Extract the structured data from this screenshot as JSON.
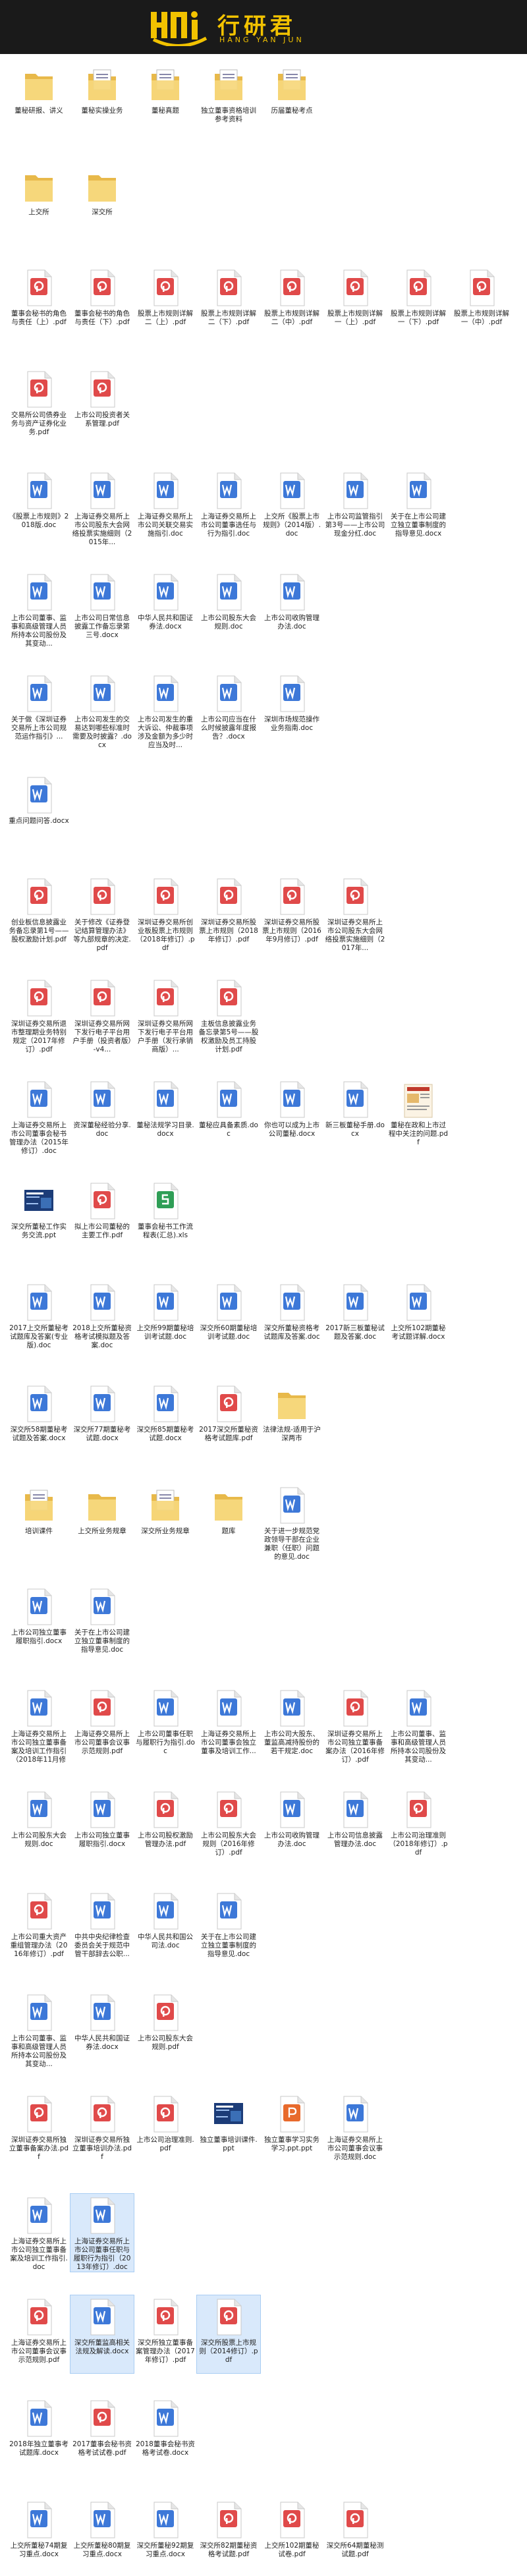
{
  "brand": {
    "name_cn": "行研君",
    "name_en": "HANG YAN JUN"
  },
  "files": [
    {
      "label": "董秘研报、讲义",
      "type": "folder"
    },
    {
      "label": "董秘实操业务",
      "type": "folder_doc"
    },
    {
      "label": "董秘真题",
      "type": "folder_doc"
    },
    {
      "label": "独立董事资格培训参考资料",
      "type": "folder_doc"
    },
    {
      "label": "历届董秘考点",
      "type": "folder_doc"
    },
    {
      "label": "上交所",
      "type": "folder"
    },
    {
      "label": "深交所",
      "type": "folder"
    },
    {
      "label": "董事会秘书的角色与责任（上）.pdf",
      "type": "pdf"
    },
    {
      "label": "董事会秘书的角色与责任（下）.pdf",
      "type": "pdf"
    },
    {
      "label": "股票上市规则详解二（上）.pdf",
      "type": "pdf"
    },
    {
      "label": "股票上市规则详解二（下）.pdf",
      "type": "pdf"
    },
    {
      "label": "股票上市规则详解二（中）.pdf",
      "type": "pdf"
    },
    {
      "label": "股票上市规则详解一（上）.pdf",
      "type": "pdf"
    },
    {
      "label": "股票上市规则详解一（下）.pdf",
      "type": "pdf"
    },
    {
      "label": "股票上市规则详解一（中）.pdf",
      "type": "pdf"
    },
    {
      "label": "交易所公司债券业务与资产证券化业务.pdf",
      "type": "pdf"
    },
    {
      "label": "上市公司投资者关系管理.pdf",
      "type": "pdf"
    },
    {
      "label": "《股票上市规则》2018版.doc",
      "type": "doc"
    },
    {
      "label": "上海证券交易所上市公司股东大会网络投票实施细则（2015年...",
      "type": "doc"
    },
    {
      "label": "上海证券交易所上市公司关联交易实施指引.doc",
      "type": "doc"
    },
    {
      "label": "上海证券交易所上市公司董事选任与行为指引.doc",
      "type": "doc"
    },
    {
      "label": "上交所《股票上市规则》（2014版）.doc",
      "type": "doc"
    },
    {
      "label": "上市公司监管指引第3号——上市公司现金分红.doc",
      "type": "doc"
    },
    {
      "label": "关于在上市公司建立独立董事制度的指导意见.docx",
      "type": "doc"
    },
    {
      "label": "上市公司董事、监事和高级管理人员所持本公司股份及其变动...",
      "type": "doc"
    },
    {
      "label": "上市公司日常信息披露工作备忘录第三号.docx",
      "type": "doc"
    },
    {
      "label": "中华人民共和国证券法.docx",
      "type": "doc"
    },
    {
      "label": "上市公司股东大会规则.doc",
      "type": "doc"
    },
    {
      "label": "上市公司收购管理办法.doc",
      "type": "doc"
    },
    {
      "label": "关于做《深圳证券交易所上市公司规范运作指引》...",
      "type": "doc"
    },
    {
      "label": "上市公司发生的交易达到哪些标准时需要及时披露？.docx",
      "type": "doc"
    },
    {
      "label": "上市公司发生的重大诉讼、仲裁事项涉及金额为多少时应当及时...",
      "type": "doc"
    },
    {
      "label": "上市公司应当在什么时候披露年度报告？.docx",
      "type": "doc"
    },
    {
      "label": "深圳市场规范操作业务指南.doc",
      "type": "doc"
    },
    {
      "label": "重点问题问答.docx",
      "type": "doc"
    },
    {
      "label": "创业板信息披露业务备忘录第1号——股权激励计划.pdf",
      "type": "pdf"
    },
    {
      "label": "关于修改《证券登记结算管理办法》等九部规章的决定.pdf",
      "type": "pdf"
    },
    {
      "label": "深圳证券交易所创业板股票上市规则（2018年修订）.pdf",
      "type": "pdf"
    },
    {
      "label": "深圳证券交易所股票上市规则（2018年修订）.pdf",
      "type": "pdf"
    },
    {
      "label": "深圳证券交易所股票上市规则（2016年9月修订）.pdf",
      "type": "pdf"
    },
    {
      "label": "深圳证券交易所上市公司股东大会网络投票实施细则（2017年...",
      "type": "pdf"
    },
    {
      "label": "深圳证券交易所退市整理期业务特别规定（2017年修订）.pdf",
      "type": "pdf"
    },
    {
      "label": "深圳证券交易所网下发行电子平台用户手册（投资者版）-v4...",
      "type": "pdf"
    },
    {
      "label": "深圳证券交易所网下发行电子平台用户手册（发行承销商版）...",
      "type": "pdf"
    },
    {
      "label": "主板信息披露业务备忘录第5号——股权激励及员工持股计划.pdf",
      "type": "pdf"
    },
    {
      "label": "上海证券交易所上市公司董事会秘书管理办法（2015年修订）.doc",
      "type": "doc"
    },
    {
      "label": "资深董秘经验分享.doc",
      "type": "doc"
    },
    {
      "label": "董秘法规学习目录.docx",
      "type": "doc"
    },
    {
      "label": "董秘应具备素质.doc",
      "type": "doc"
    },
    {
      "label": "你也可以成为上市公司董秘.docx",
      "type": "doc"
    },
    {
      "label": "新三板董秘手册.docx",
      "type": "doc"
    },
    {
      "label": "董秘在政和上市过程中关注的问题.pdf",
      "type": "pdf_img"
    },
    {
      "label": "深交所董秘工作实务交流.ppt",
      "type": "ppt_img"
    },
    {
      "label": "拟上市公司董秘的主要工作.pdf",
      "type": "pdf"
    },
    {
      "label": "董事会秘书工作流程表(汇总).xls",
      "type": "xls"
    },
    {
      "label": "2017上交所董秘考试题库及答案(专业版).doc",
      "type": "doc"
    },
    {
      "label": "2018上交所董秘资格考试模拟题及答案.doc",
      "type": "doc"
    },
    {
      "label": "上交所99期董秘培训考试题.doc",
      "type": "doc"
    },
    {
      "label": "深交所60期董秘培训考试题.doc",
      "type": "doc"
    },
    {
      "label": "深交所董秘资格考试题库及答案.doc",
      "type": "doc"
    },
    {
      "label": "2017新三板董秘试题及答案.doc",
      "type": "doc"
    },
    {
      "label": "上交所102期董秘考试题详解.docx",
      "type": "doc"
    },
    {
      "label": "深交所58期董秘考试题及答案.docx",
      "type": "doc"
    },
    {
      "label": "深交所77期董秘考试题.docx",
      "type": "doc"
    },
    {
      "label": "深交所85期董秘考试题.docx",
      "type": "doc"
    },
    {
      "label": "2017深交所董秘资格考试题库.pdf",
      "type": "pdf"
    },
    {
      "label": "法律法规-适用于沪深两市",
      "type": "folder"
    },
    {
      "label": "培训课件",
      "type": "folder_doc"
    },
    {
      "label": "上交所业务规章",
      "type": "folder"
    },
    {
      "label": "深交所业务规章",
      "type": "folder_doc"
    },
    {
      "label": "题库",
      "type": "folder"
    },
    {
      "label": "关于进一步规范党政领导干部在企业兼职（任职）问题的意见.doc",
      "type": "doc"
    },
    {
      "label": "上市公司独立董事履职指引.docx",
      "type": "doc"
    },
    {
      "label": "关于在上市公司建立独立董事制度的指导意见.doc",
      "type": "doc"
    },
    {
      "label": "上海证券交易所上市公司独立董事备案及培训工作指引（2018年11月修订）.doc",
      "type": "doc"
    },
    {
      "label": "上海证券交易所上市公司董事会议事示范规则.pdf",
      "type": "pdf"
    },
    {
      "label": "上市公司董事任职与履职行为指引.doc",
      "type": "doc"
    },
    {
      "label": "上海证券交易所上市公司董事会独立董事及培训工作...",
      "type": "doc"
    },
    {
      "label": "上市公司大股东、董监高减持股份的若干规定.doc",
      "type": "doc"
    },
    {
      "label": "深圳证券交易所上市公司独立董事备案办法（2016年修订）.pdf",
      "type": "pdf"
    },
    {
      "label": "上市公司董事、监事和高级管理人员所持本公司股份及其变动...",
      "type": "doc"
    },
    {
      "label": "上市公司股东大会规则.doc",
      "type": "doc"
    },
    {
      "label": "上市公司独立董事履职指引.docx",
      "type": "doc"
    },
    {
      "label": "上市公司股权激励管理办法.pdf",
      "type": "pdf"
    },
    {
      "label": "上市公司股东大会规则（2016年修订）.pdf",
      "type": "pdf"
    },
    {
      "label": "上市公司收购管理办法.doc",
      "type": "doc"
    },
    {
      "label": "上市公司信息披露管理办法.doc",
      "type": "doc"
    },
    {
      "label": "上市公司治理准则（2018年修订）.pdf",
      "type": "pdf"
    },
    {
      "label": "上市公司重大资产重组管理办法（2016年修订）.pdf",
      "type": "pdf"
    },
    {
      "label": "中共中央纪律检查委员会关于规范中管干部辞去公职...",
      "type": "doc"
    },
    {
      "label": "中华人民共和国公司法.doc",
      "type": "doc"
    },
    {
      "label": "关于在上市公司建立独立董事制度的指导意见.doc",
      "type": "doc"
    },
    {
      "label": "上市公司董事、监事和高级管理人员所持本公司股份及其变动...",
      "type": "doc"
    },
    {
      "label": "中华人民共和国证券法.docx",
      "type": "doc"
    },
    {
      "label": "上市公司股东大会规则.pdf",
      "type": "pdf"
    },
    {
      "label": "深圳证券交易所独立董事备案办法.pdf",
      "type": "pdf"
    },
    {
      "label": "深圳证券交易所独立董事培训办法.pdf",
      "type": "pdf"
    },
    {
      "label": "上市公司治理准则.pdf",
      "type": "pdf"
    },
    {
      "label": "独立董事培训课件.ppt",
      "type": "ppt_img"
    },
    {
      "label": "独立董事学习实务学习.ppt.ppt",
      "type": "ppt_plain"
    },
    {
      "label": "上海证券交易所上市公司董事会议事示范规则.doc",
      "type": "doc"
    },
    {
      "label": "上海证券交易所上市公司独立董事备案及培训工作指引.doc",
      "type": "doc"
    },
    {
      "label": "上海证券交易所上市公司董事任职与履职行为指引（2013年修订）.doc",
      "type": "doc",
      "sel": true
    },
    {
      "label": "上海证券交易所上市公司董事会议事示范规则.pdf",
      "type": "pdf"
    },
    {
      "label": "深交所董监高相关法规及解读.docx",
      "type": "doc",
      "sel": true
    },
    {
      "label": "深交所独立董事备案管理办法（2017年修订）.pdf",
      "type": "pdf"
    },
    {
      "label": "深交所股票上市规则（2014修订）.pdf",
      "type": "pdf",
      "sel": true
    },
    {
      "label": "2018年独立董事考试题库.docx",
      "type": "doc"
    },
    {
      "label": "2017董事会秘书资格考试试卷.pdf",
      "type": "pdf"
    },
    {
      "label": "2018董事会秘书资格考试卷.docx",
      "type": "doc"
    },
    {
      "label": "上交所董秘74期复习重点.docx",
      "type": "doc"
    },
    {
      "label": "上交所董秘80期复习重点.docx",
      "type": "doc"
    },
    {
      "label": "深交所董秘92期复习重点.docx",
      "type": "doc"
    },
    {
      "label": "深交所82期董秘资格考试题.pdf",
      "type": "pdf"
    },
    {
      "label": "上交所102期董秘试卷.pdf",
      "type": "pdf"
    },
    {
      "label": "深交所64期董秘测试题.pdf",
      "type": "pdf"
    }
  ]
}
